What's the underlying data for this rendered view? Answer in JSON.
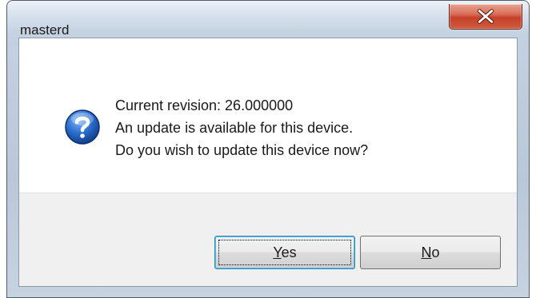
{
  "window": {
    "title": "masterd"
  },
  "icons": {
    "close": "close-icon",
    "message": "question-icon"
  },
  "message": {
    "lines": [
      "Current revision: 26.000000",
      "An update is available for this device.",
      "Do you wish to update this device now?"
    ]
  },
  "buttons": {
    "yes": {
      "accel": "Y",
      "rest": "es"
    },
    "no": {
      "accel": "N",
      "rest": "o"
    }
  },
  "colors": {
    "close_button": "#c7412a",
    "question_icon": "#1f5fb7",
    "default_button_border": "#3c7fb1"
  }
}
